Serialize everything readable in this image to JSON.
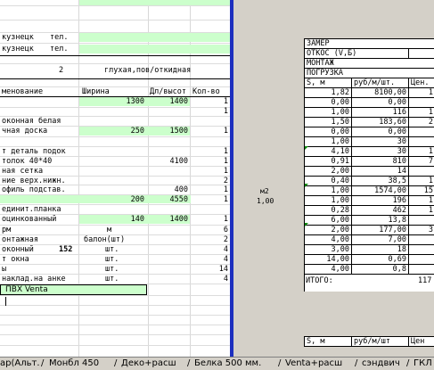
{
  "left": {
    "r0": {
      "a": "кузнецк",
      "b": "тел."
    },
    "r1": {
      "a": "кузнецк",
      "b": "тел."
    },
    "r2": {
      "num": "2",
      "text": "глухая,пов/откидная"
    },
    "headers": {
      "name": "менование",
      "width": "Ширина",
      "height": "Дл/высот",
      "qty": "Кол-во"
    },
    "items": [
      {
        "name": "",
        "width": "1300",
        "height": "1400",
        "qty": "1"
      },
      {
        "name": "",
        "width": "",
        "height": "",
        "qty": "1"
      },
      {
        "name": "оконная белая",
        "width": "",
        "height": "",
        "qty": ""
      },
      {
        "name": "чная доска",
        "width": "250",
        "height": "1500",
        "qty": "1"
      },
      {
        "name": "",
        "width": "",
        "height": "",
        "qty": ""
      },
      {
        "name": "т деталь подок",
        "width": "",
        "height": "",
        "qty": "1"
      },
      {
        "name": "толок 40*40",
        "width": "",
        "height": "4100",
        "qty": "1"
      },
      {
        "name": "ная сетка",
        "width": "",
        "height": "",
        "qty": "1"
      },
      {
        "name": "ние верх.нижн.",
        "width": "",
        "height": "",
        "qty": "2"
      },
      {
        "name": "офиль подстав.",
        "width": "",
        "height": "400",
        "qty": "1"
      },
      {
        "name": "",
        "width": "200",
        "height": "4550",
        "qty": "1"
      },
      {
        "name": "единит.планка",
        "width": "",
        "height": "",
        "qty": ""
      },
      {
        "name": "оцинкованный",
        "width": "140",
        "height": "1400",
        "qty": "1"
      },
      {
        "name": "рм",
        "width": "м",
        "height": "",
        "qty": "6"
      },
      {
        "name": "онтажная",
        "width": "балон(шт)",
        "height": "",
        "qty": "2"
      },
      {
        "name": "оконный",
        "extra": "152",
        "width": "шт.",
        "height": "",
        "qty": "4"
      },
      {
        "name": "т окна",
        "width": "шт.",
        "height": "",
        "qty": "4"
      },
      {
        "name": "ы",
        "width": "шт.",
        "height": "",
        "qty": "14"
      },
      {
        "name": "наклад.на анке",
        "width": "шт.",
        "height": "",
        "qty": "4"
      }
    ],
    "footer_label": "ПВХ Venta"
  },
  "mid": {
    "unit": "м2",
    "value": "1,00"
  },
  "right": {
    "labels": [
      "ЗАМЕР",
      "ОТКОС (V,Б)",
      "МОНТАЖ",
      "ПОГРУЗКА"
    ],
    "headers": [
      "S, м",
      "руб/м/шт.",
      "Цен."
    ],
    "rows": [
      {
        "s": "1,82",
        "p": "8100,00",
        "c": "1"
      },
      {
        "s": "0,00",
        "p": "0,00",
        "c": ""
      },
      {
        "s": "1,00",
        "p": "116",
        "c": "1"
      },
      {
        "s": "1,50",
        "p": "183,60",
        "c": "2"
      },
      {
        "s": "0,00",
        "p": "0,00",
        "c": ""
      },
      {
        "s": "1,00",
        "p": "30",
        "c": ""
      },
      {
        "s": "4,10",
        "p": "30",
        "c": "1"
      },
      {
        "s": "0,91",
        "p": "810",
        "c": "7"
      },
      {
        "s": "2,00",
        "p": "14",
        "c": ""
      },
      {
        "s": "0,40",
        "p": "38,5",
        "c": "1"
      },
      {
        "s": "1,00",
        "p": "1574,00",
        "c": "15"
      },
      {
        "s": "1,00",
        "p": "196",
        "c": "1"
      },
      {
        "s": "0,28",
        "p": "462",
        "c": "1"
      },
      {
        "s": "6,00",
        "p": "13,8",
        "c": ""
      },
      {
        "s": "2,00",
        "p": "177,00",
        "c": "3"
      },
      {
        "s": "4,00",
        "p": "7,00",
        "c": ""
      },
      {
        "s": "3,00",
        "p": "18",
        "c": ""
      },
      {
        "s": "14,00",
        "p": "0,69",
        "c": ""
      },
      {
        "s": "4,00",
        "p": "0,8",
        "c": ""
      }
    ],
    "total_label": "ИТОГО:",
    "total_value": "117",
    "bottom_headers": [
      "S, м",
      "руб/м/шт",
      "Цен"
    ]
  },
  "tabs": [
    "ар(Альт.",
    "Монбл 450",
    "Деко+расш",
    "Белка 500 мм.",
    "Venta+расш",
    "сэндвич",
    "ГКЛ"
  ]
}
